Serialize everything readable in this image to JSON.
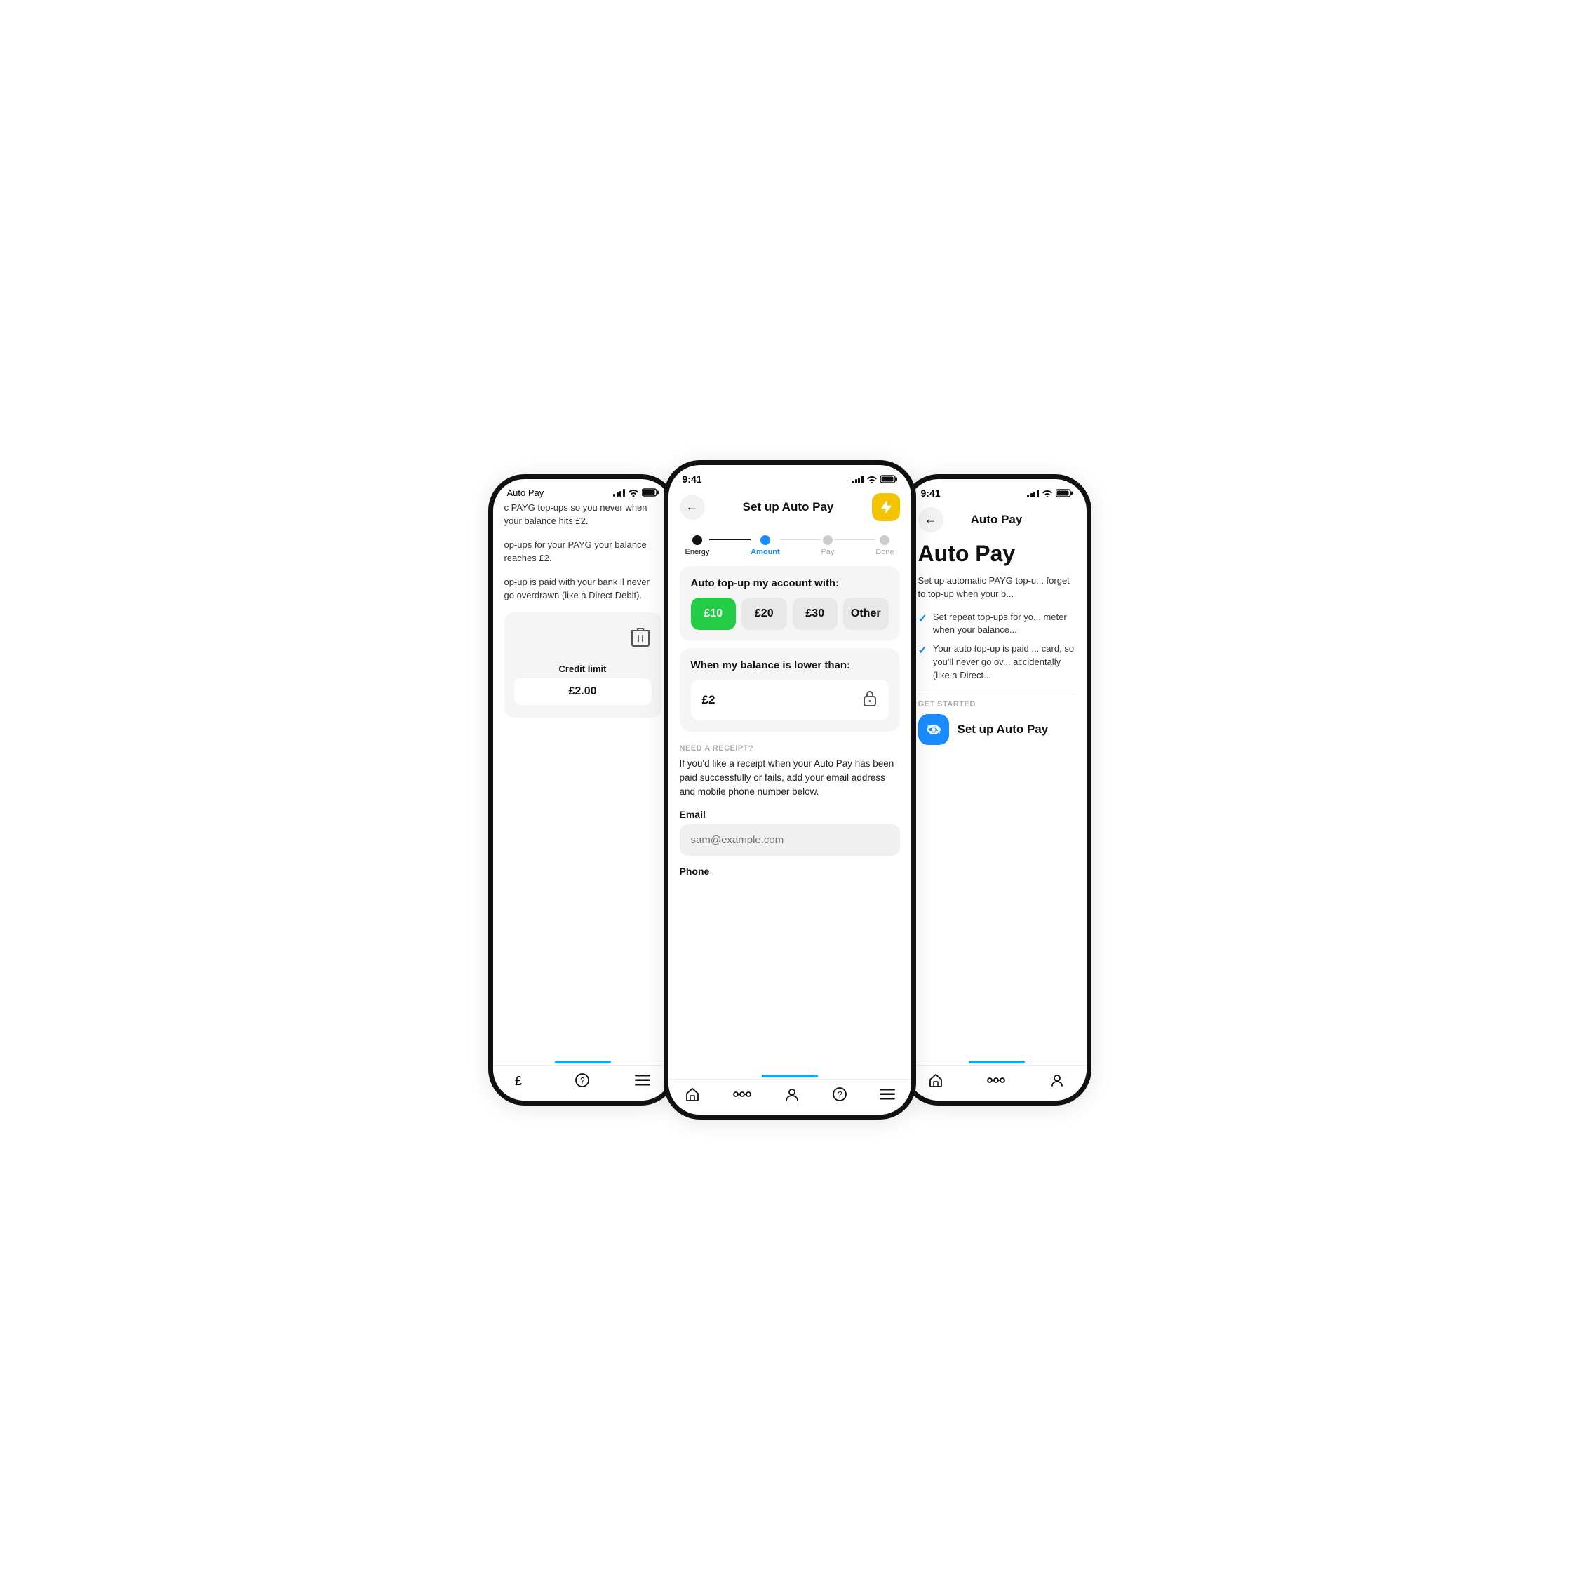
{
  "colors": {
    "accent_blue": "#1a8cff",
    "accent_green": "#22cc44",
    "accent_yellow": "#f5c400",
    "bg": "#fff",
    "card_bg": "#f5f5f5",
    "text_primary": "#111",
    "text_secondary": "#aaa",
    "tab_indicator": "#00aaff"
  },
  "left_phone": {
    "status_bar": {
      "title": "Auto Pay"
    },
    "body_text_1": "c PAYG top-ups so you never when your balance hits £2.",
    "body_text_2": "op-ups for your PAYG your balance reaches £2.",
    "body_text_3": "op-up is paid with your bank ll never go overdrawn (like a Direct Debit).",
    "credit_limit_label": "Credit limit",
    "credit_limit_value": "£2.00",
    "bottom_nav": [
      "£",
      "?",
      "≡"
    ]
  },
  "center_phone": {
    "status_bar": {
      "time": "9:41"
    },
    "header": {
      "back_label": "←",
      "title": "Set up Auto Pay",
      "icon": "⚡"
    },
    "stepper": {
      "steps": [
        {
          "label": "Energy",
          "state": "done"
        },
        {
          "label": "Amount",
          "state": "active"
        },
        {
          "label": "Pay",
          "state": "todo"
        },
        {
          "label": "Done",
          "state": "todo"
        }
      ]
    },
    "amount_section": {
      "title": "Auto top-up my account with:",
      "options": [
        {
          "value": "£10",
          "selected": true
        },
        {
          "value": "£20",
          "selected": false
        },
        {
          "value": "£30",
          "selected": false
        },
        {
          "value": "Other",
          "selected": false
        }
      ]
    },
    "balance_section": {
      "title": "When my balance is lower than:",
      "value": "£2"
    },
    "receipt_section": {
      "label": "NEED A RECEIPT?",
      "text": "If you'd like a receipt when your Auto Pay has been paid successfully or fails, add your email address and mobile phone number below.",
      "email_label": "Email",
      "email_placeholder": "sam@example.com",
      "phone_label": "Phone"
    },
    "bottom_nav": [
      "home",
      "network",
      "account",
      "help",
      "menu"
    ]
  },
  "right_phone": {
    "status_bar": {
      "time": "9:41"
    },
    "header": {
      "back_label": "←",
      "title": "Auto Pay"
    },
    "big_title": "Auto Pay",
    "desc": "Set up automatic PAYG top-u... forget to top-up when your b...",
    "check_items": [
      "Set repeat top-ups for yo... meter when your balance...",
      "Your auto top-up is paid ... card, so you'll never go ov... accidentally (like a Direct..."
    ],
    "get_started_label": "GET STARTED",
    "setup_btn_label": "Set up Auto Pay",
    "bottom_nav": [
      "home",
      "network",
      "account"
    ]
  }
}
